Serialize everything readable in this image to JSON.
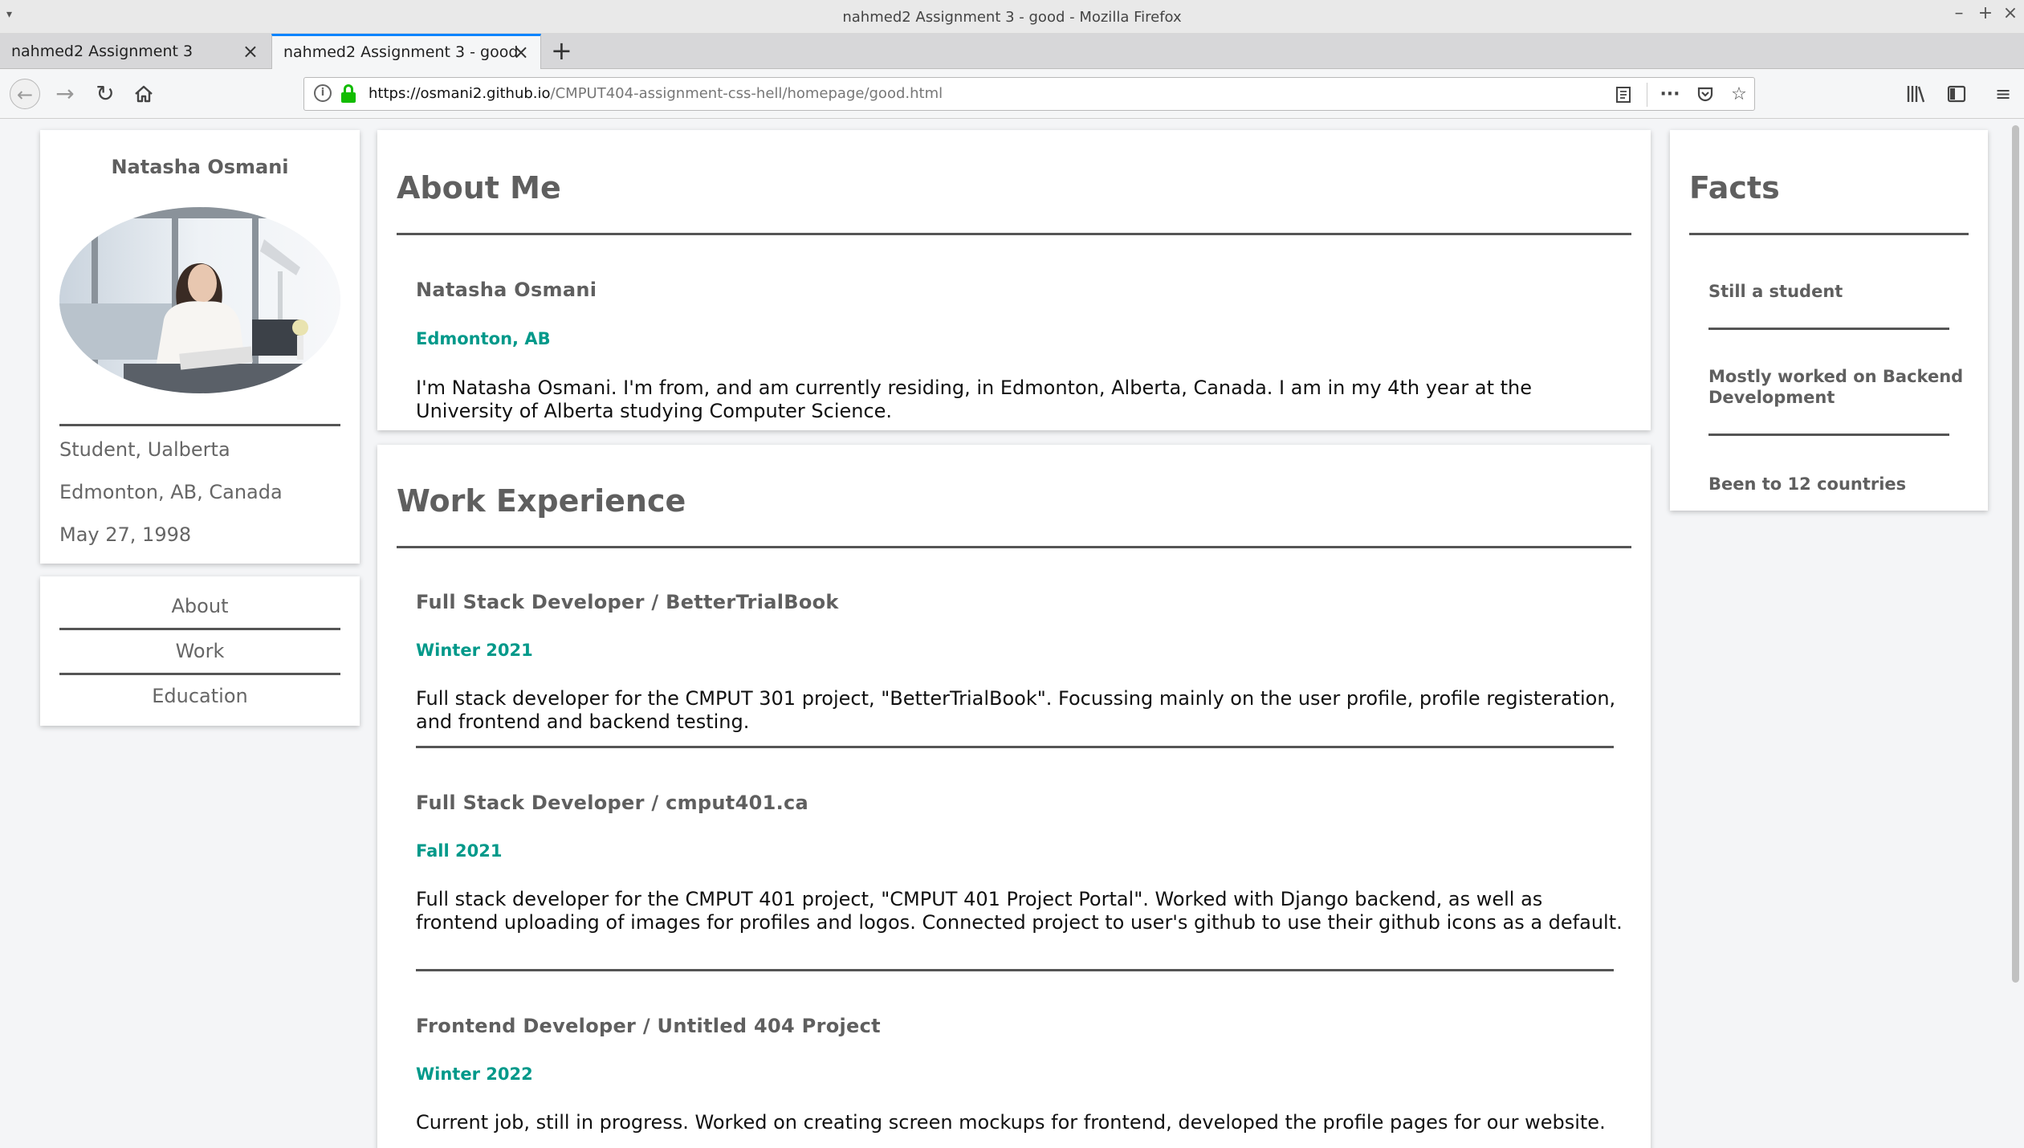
{
  "window": {
    "title": "nahmed2 Assignment 3 - good - Mozilla Firefox"
  },
  "tabs": [
    {
      "label": "nahmed2 Assignment 3"
    },
    {
      "label": "nahmed2 Assignment 3 - good"
    }
  ],
  "urlbar": {
    "domain": "https://osmani2.github.io",
    "path": "/CMPUT404-assignment-css-hell/homepage/good.html"
  },
  "profile": {
    "name": "Natasha Osmani",
    "role": "Student, Ualberta",
    "location": "Edmonton, AB, Canada",
    "birthday": "May 27, 1998"
  },
  "nav": {
    "items": [
      "About",
      "Work",
      "Education"
    ]
  },
  "about": {
    "heading": "About Me",
    "name": "Natasha Osmani",
    "location": "Edmonton, AB",
    "bio": "I'm Natasha Osmani. I'm from, and am currently residing, in Edmonton, Alberta, Canada. I am in my 4th year at the University of Alberta studying Computer Science."
  },
  "work": {
    "heading": "Work Experience",
    "jobs": [
      {
        "title": "Full Stack Developer / BetterTrialBook",
        "date": "Winter 2021",
        "desc": "Full stack developer for the CMPUT 301 project, \"BetterTrialBook\". Focussing mainly on the user profile, profile registeration, and frontend and backend testing."
      },
      {
        "title": "Full Stack Developer / cmput401.ca",
        "date": "Fall 2021",
        "desc": "Full stack developer for the CMPUT 401 project, \"CMPUT 401 Project Portal\". Worked with Django backend, as well as frontend uploading of images for profiles and logos. Connected project to user's github to use their github icons as a default."
      },
      {
        "title": "Frontend Developer / Untitled 404 Project",
        "date": "Winter 2022",
        "desc": "Current job, still in progress. Worked on creating screen mockups for frontend, developed the profile pages for our website."
      }
    ]
  },
  "facts": {
    "heading": "Facts",
    "items": [
      "Still a student",
      "Mostly worked on Backend Development",
      "Been to 12 countries"
    ]
  }
}
